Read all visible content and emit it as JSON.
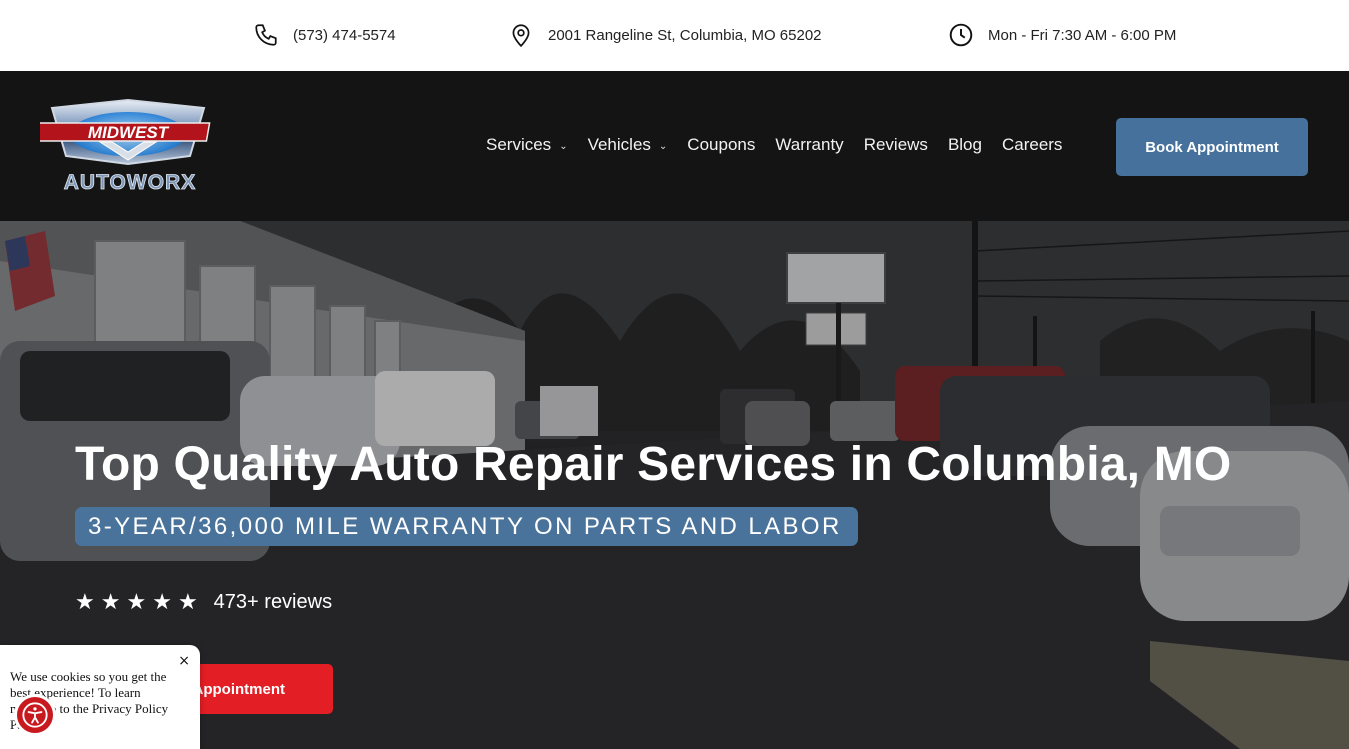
{
  "topbar": {
    "phone": "(573) 474-5574",
    "address": "2001 Rangeline St, Columbia, MO 65202",
    "hours": "Mon - Fri 7:30 AM - 6:00 PM",
    "icons": [
      "phone-icon",
      "location-pin-icon",
      "clock-icon"
    ]
  },
  "header": {
    "logo_text_top": "MIDWEST",
    "logo_text_bottom": "AUTOWORX",
    "nav": [
      {
        "label": "Services",
        "dropdown": true
      },
      {
        "label": "Vehicles",
        "dropdown": true
      },
      {
        "label": "Coupons",
        "dropdown": false
      },
      {
        "label": "Warranty",
        "dropdown": false
      },
      {
        "label": "Reviews",
        "dropdown": false
      },
      {
        "label": "Blog",
        "dropdown": false
      },
      {
        "label": "Careers",
        "dropdown": false
      }
    ],
    "book_button": "Book Appointment"
  },
  "hero": {
    "title": "Top Quality Auto Repair Services in Columbia, MO",
    "badge": "3-YEAR/36,000 MILE WARRANTY ON PARTS AND LABOR",
    "rating_stars": 5,
    "reviews": "473+ reviews",
    "cta": "Appointment"
  },
  "cookie": {
    "text": "We use cookies so you get the best experience! To learn more, go to the Privacy Policy Page.",
    "close": "×"
  },
  "colors": {
    "accent_blue": "#45719c",
    "cta_red": "#e31e24",
    "header_bg": "#141414"
  }
}
